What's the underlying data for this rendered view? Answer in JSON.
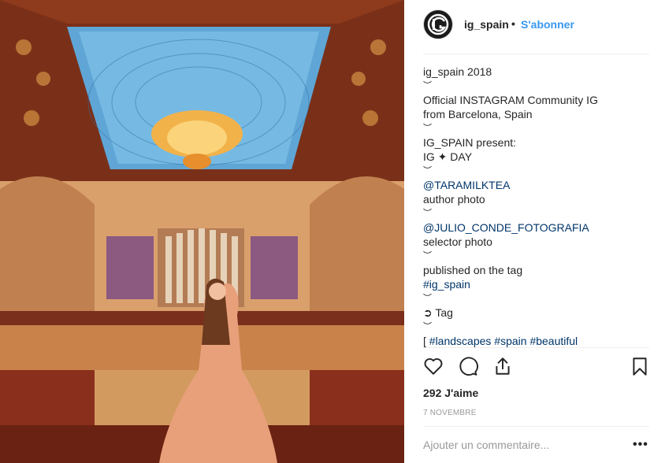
{
  "post": {
    "username": "ig_spain",
    "dot": "•",
    "follow_label": "S'abonner",
    "caption_lines": [
      {
        "text": "ig_spain 2018",
        "link": false
      },
      {
        "text": "︶",
        "link": false
      },
      {
        "text": "Official INSTAGRAM Community IG",
        "link": false
      },
      {
        "text": "from Barcelona, Spain",
        "link": false
      },
      {
        "text": "︶",
        "link": false
      },
      {
        "text": "IG_SPAIN present:",
        "link": false
      },
      {
        "text": "IG ✦ DAY",
        "link": false
      },
      {
        "text": "︶",
        "link": false
      },
      {
        "text": "@TARAMILKTEA",
        "link": true
      },
      {
        "text": "author photo",
        "link": false
      },
      {
        "text": "︶",
        "link": false
      },
      {
        "text": "@JULIO_CONDE_FOTOGRAFIA",
        "link": true
      },
      {
        "text": "selector photo",
        "link": false
      },
      {
        "text": "︶",
        "link": false
      },
      {
        "text": "published on the tag",
        "link": false
      },
      {
        "text": "#ig_spain",
        "link": true
      },
      {
        "text": "︶",
        "link": false
      },
      {
        "text": "➲ Tag",
        "link": false
      },
      {
        "text": "︶",
        "link": false
      },
      {
        "text": "[ #landscapes #spain #beautiful",
        "link": "partial"
      }
    ],
    "likes": "292 J'aime",
    "date": "7 NOVEMBRE",
    "comment_placeholder": "Ajouter un commentaire...",
    "more_label": "•••"
  },
  "icons": {
    "like": "heart-icon",
    "comment": "comment-bubble-icon",
    "share": "share-icon",
    "save": "bookmark-icon",
    "avatar": "ig-logo-avatar"
  },
  "colors": {
    "accent": "#3897f0",
    "link": "#003569",
    "text": "#262626",
    "muted": "#999999"
  }
}
